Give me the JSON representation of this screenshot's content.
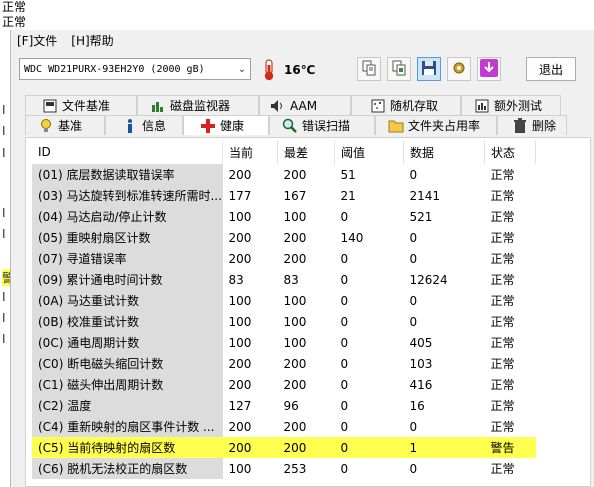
{
  "background": {
    "status_top_1": "正常",
    "status_top_2": "正常",
    "frag_1": "I",
    "frag_2": "I",
    "frag_3": "I",
    "frag_4": "I",
    "frag_5": "I",
    "frag_6": "警",
    "frag_7": "I",
    "frag_8": "I",
    "frag_9": "I"
  },
  "menu": {
    "file": "[F]文件",
    "help": "[H]帮助"
  },
  "toolbar": {
    "drive": "WDC WD21PURX-93EH2Y0 (2000 gB)",
    "temperature": "16℃",
    "exit_label": "退出"
  },
  "tabs_row1": [
    {
      "label": "文件基准",
      "icon": "benchmark-icon"
    },
    {
      "label": "磁盘监视器",
      "icon": "monitor-chart-icon"
    },
    {
      "label": "AAM",
      "icon": "speaker-icon"
    },
    {
      "label": "随机存取",
      "icon": "random-access-icon"
    },
    {
      "label": "额外测试",
      "icon": "extra-tests-icon"
    }
  ],
  "tabs_row2": [
    {
      "label": "基准",
      "icon": "lightbulb-icon"
    },
    {
      "label": "信息",
      "icon": "info-icon"
    },
    {
      "label": "健康",
      "icon": "health-cross-icon"
    },
    {
      "label": "错误扫描",
      "icon": "magnifier-icon"
    },
    {
      "label": "文件夹占用率",
      "icon": "folder-icon"
    },
    {
      "label": "删除",
      "icon": "trash-icon"
    }
  ],
  "table": {
    "headers": [
      "ID",
      "当前",
      "最差",
      "阈值",
      "数据",
      "状态"
    ],
    "rows": [
      [
        "(01) 底层数据读取错误率",
        "200",
        "200",
        "51",
        "0",
        "正常"
      ],
      [
        "(03) 马达旋转到标准转速所需时...",
        "177",
        "167",
        "21",
        "2141",
        "正常"
      ],
      [
        "(04) 马达启动/停止计数",
        "100",
        "100",
        "0",
        "521",
        "正常"
      ],
      [
        "(05) 重映射扇区计数",
        "200",
        "200",
        "140",
        "0",
        "正常"
      ],
      [
        "(07) 寻道错误率",
        "200",
        "200",
        "0",
        "0",
        "正常"
      ],
      [
        "(09) 累计通电时间计数",
        "83",
        "83",
        "0",
        "12624",
        "正常"
      ],
      [
        "(0A) 马达重试计数",
        "100",
        "100",
        "0",
        "0",
        "正常"
      ],
      [
        "(0B) 校准重试计数",
        "100",
        "100",
        "0",
        "0",
        "正常"
      ],
      [
        "(0C) 通电周期计数",
        "100",
        "100",
        "0",
        "405",
        "正常"
      ],
      [
        "(C0) 断电磁头缩回计数",
        "200",
        "200",
        "0",
        "103",
        "正常"
      ],
      [
        "(C1) 磁头伸出周期计数",
        "200",
        "200",
        "0",
        "416",
        "正常"
      ],
      [
        "(C2) 温度",
        "127",
        "96",
        "0",
        "16",
        "正常"
      ],
      [
        "(C4) 重新映射的扇区事件计数 ...",
        "200",
        "200",
        "0",
        "0",
        "正常"
      ],
      [
        "(C5) 当前待映射的扇区数",
        "200",
        "200",
        "0",
        "1",
        "警告"
      ],
      [
        "(C6) 脱机无法校正的扇区数",
        "100",
        "253",
        "0",
        "0",
        "正常"
      ]
    ],
    "warning_row_index": 13,
    "warning_color": "#ffff4f"
  }
}
